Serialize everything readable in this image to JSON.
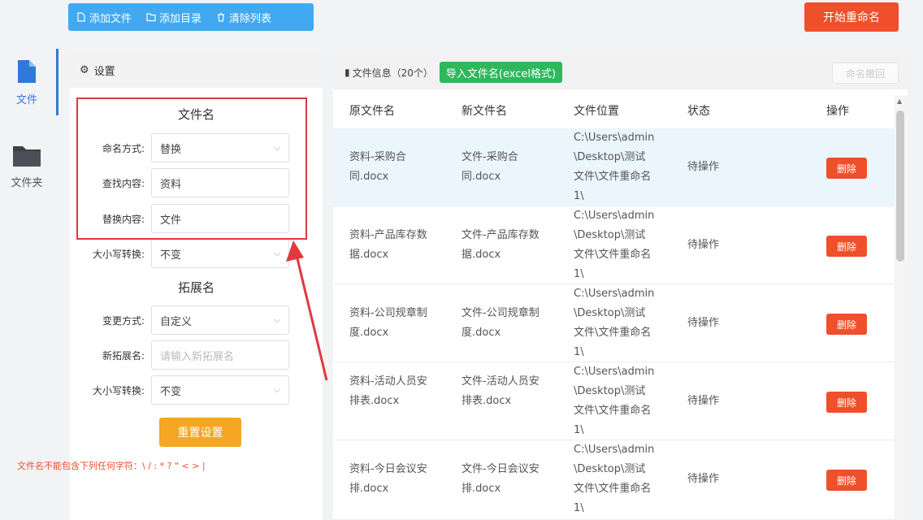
{
  "sidebar": {
    "items": [
      {
        "label": "文件",
        "icon": "file-icon",
        "active": true
      },
      {
        "label": "文件夹",
        "icon": "folder-icon",
        "active": false
      }
    ]
  },
  "toolbar": {
    "add_file": "添加文件",
    "add_dir": "添加目录",
    "clear_list": "清除列表",
    "start_rename": "开始重命名"
  },
  "settings": {
    "title": "设置",
    "filename_section": "文件名",
    "rename_mode_label": "命名方式:",
    "rename_mode_value": "替换",
    "find_label": "查找内容:",
    "find_value": "资料",
    "replace_label": "替换内容:",
    "replace_value": "文件",
    "case_label": "大小写转换:",
    "case_value": "不变",
    "ext_section": "拓展名",
    "ext_mode_label": "变更方式:",
    "ext_mode_value": "自定义",
    "new_ext_label": "新拓展名:",
    "new_ext_placeholder": "请输入新拓展名",
    "ext_case_label": "大小写转换:",
    "ext_case_value": "不变",
    "reset_button": "重置设置",
    "warning": "文件名不能包含下列任何字符：\\ / : * ? \" < > |"
  },
  "files": {
    "title": "文件信息（20个）",
    "import_button": "导入文件名(excel格式)",
    "undo_button": "命名撤回",
    "headers": [
      "原文件名",
      "新文件名",
      "文件位置",
      "状态",
      "操作"
    ],
    "rows": [
      {
        "orig": "资料-采购合同.docx",
        "new": "文件-采购合同.docx",
        "loc": "C:\\Users\\admin\\Desktop\\测试文件\\文件重命名1\\",
        "status": "待操作",
        "action": "删除"
      },
      {
        "orig": "资料-产品库存数据.docx",
        "new": "文件-产品库存数据.docx",
        "loc": "C:\\Users\\admin\\Desktop\\测试文件\\文件重命名1\\",
        "status": "待操作",
        "action": "删除"
      },
      {
        "orig": "资料-公司规章制度.docx",
        "new": "文件-公司规章制度.docx",
        "loc": "C:\\Users\\admin\\Desktop\\测试文件\\文件重命名1\\",
        "status": "待操作",
        "action": "删除"
      },
      {
        "orig": "资料-活动人员安排表.docx",
        "new": "文件-活动人员安排表.docx",
        "loc": "C:\\Users\\admin\\Desktop\\测试文件\\文件重命名1\\",
        "status": "待操作",
        "action": "删除"
      },
      {
        "orig": "资料-今日会议安排.docx",
        "new": "文件-今日会议安排.docx",
        "loc": "C:\\Users\\admin\\Desktop\\测试文件\\文件重命名1\\",
        "status": "待操作",
        "action": "删除"
      }
    ]
  },
  "colors": {
    "accent": "#2f7ad8",
    "toolbar": "#41a9f0",
    "danger": "#ef4f2a",
    "success": "#2eb85c",
    "warning": "#f5a623"
  }
}
